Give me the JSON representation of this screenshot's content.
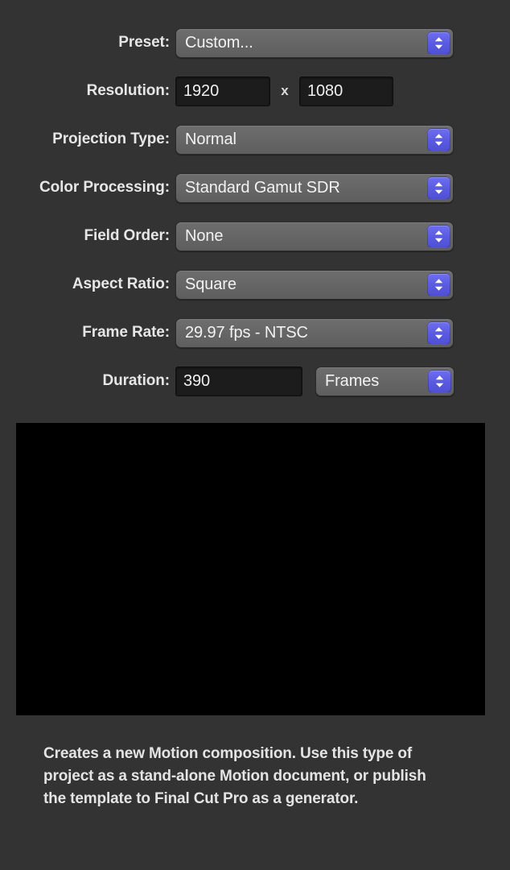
{
  "panel": {
    "background_color": "#333333",
    "accent_color": "#5a5ae0",
    "popup_color": "#666666",
    "field_color": "#1c1c1c"
  },
  "form": {
    "preset": {
      "label": "Preset:",
      "value": "Custom...",
      "control": "popup-button",
      "stepper_icon": "chevron-up-down-icon"
    },
    "resolution": {
      "label": "Resolution:",
      "width_value": "1920",
      "height_value": "1080",
      "separator": "x",
      "control": "text-fields"
    },
    "projection_type": {
      "label": "Projection Type:",
      "value": "Normal",
      "control": "popup-button",
      "stepper_icon": "chevron-up-down-icon"
    },
    "color_processing": {
      "label": "Color Processing:",
      "value": "Standard Gamut SDR",
      "control": "popup-button",
      "stepper_icon": "chevron-up-down-icon"
    },
    "field_order": {
      "label": "Field Order:",
      "value": "None",
      "control": "popup-button",
      "stepper_icon": "chevron-up-down-icon"
    },
    "aspect_ratio": {
      "label": "Aspect Ratio:",
      "value": "Square",
      "control": "popup-button",
      "stepper_icon": "chevron-up-down-icon"
    },
    "frame_rate": {
      "label": "Frame Rate:",
      "value": "29.97 fps - NTSC",
      "control": "popup-button",
      "stepper_icon": "chevron-up-down-icon"
    },
    "duration": {
      "label": "Duration:",
      "value": "390",
      "unit_value": "Frames",
      "control": "text-field-plus-popup",
      "stepper_icon": "chevron-up-down-icon"
    }
  },
  "preview": {
    "name": "project-preview-thumbnail",
    "color": "#000000"
  },
  "description": {
    "text": "Creates a new Motion composition. Use this type of project as a stand-alone Motion document, or publish the template to Final Cut Pro as a generator."
  }
}
